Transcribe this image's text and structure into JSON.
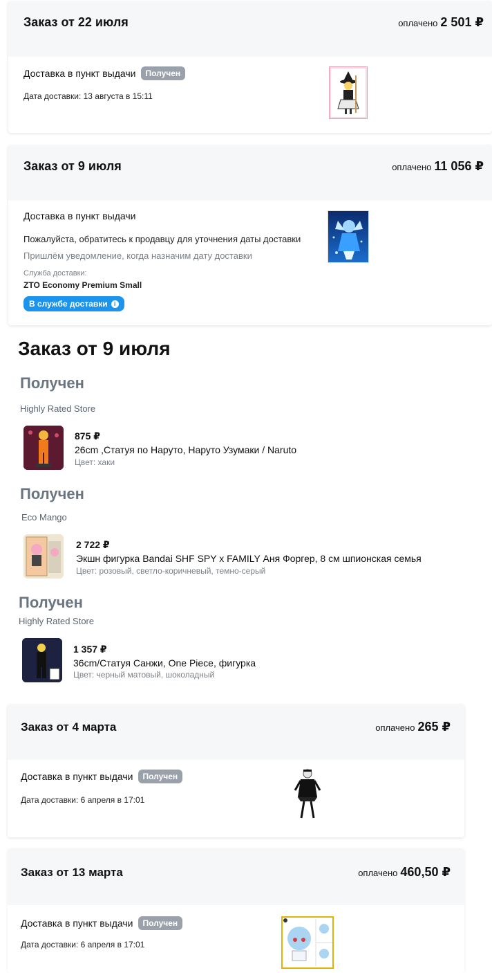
{
  "orders": [
    {
      "title": "Заказ от 22 июля",
      "paid_label": "оплачено",
      "paid_amount": "2 501 ₽",
      "delivery_label": "Доставка в пункт выдачи",
      "status_badge": "Получен",
      "delivery_date": "Дата доставки: 13 августа в 15:11"
    },
    {
      "title": "Заказ от 9 июля",
      "paid_label": "оплачено",
      "paid_amount": "11 056 ₽",
      "delivery_label": "Доставка в пункт выдачи",
      "contact_note": "Пожалуйста, обратитесь к продавцу для уточнения даты доставки",
      "notify_note": "Пришлём уведомление, когда назначим дату доставки",
      "service_label": "Служба доставки:",
      "service_name": "ZTO Economy Premium Small",
      "service_badge": "В службе доставки"
    },
    {
      "title": "Заказ от 4 марта",
      "paid_label": "оплачено",
      "paid_amount": "265 ₽",
      "delivery_label": "Доставка в пункт выдачи",
      "status_badge": "Получен",
      "delivery_date": "Дата доставки: 6 апреля в 17:01"
    },
    {
      "title": "Заказ от 13 марта",
      "paid_label": "оплачено",
      "paid_amount": "460,50 ₽",
      "delivery_label": "Доставка в пункт выдачи",
      "status_badge": "Получен",
      "delivery_date": "Дата доставки: 6 апреля в 17:01"
    }
  ],
  "detail": {
    "title": "Заказ от 9 июля",
    "groups": [
      {
        "status": "Получен",
        "store": "Highly Rated Store",
        "price": "875 ₽",
        "name": "26cm ,Статуя по Наруто, Наруто Узумаки / Naruto",
        "color": "Цвет: хаки"
      },
      {
        "status": "Получен",
        "store": "Eco Mango",
        "price": "2 722 ₽",
        "name": "Экшн фигурка Bandai SHF SPY x FAMILY Аня Форгер, 8 см шпионская семья",
        "color": "Цвет: розовый, светло-коричневый, темно-серый"
      },
      {
        "status": "Получен",
        "store": "Highly Rated Store",
        "price": "1 357 ₽",
        "name": "36cm/Статуя Санжи, One Piece, фигурка",
        "color": "Цвет: черный матовый, шоколадный"
      }
    ]
  },
  "colors": {
    "accent_blue": "#1a94ec",
    "badge_gray": "#9aa1ab",
    "status_gray": "#6a7581"
  }
}
